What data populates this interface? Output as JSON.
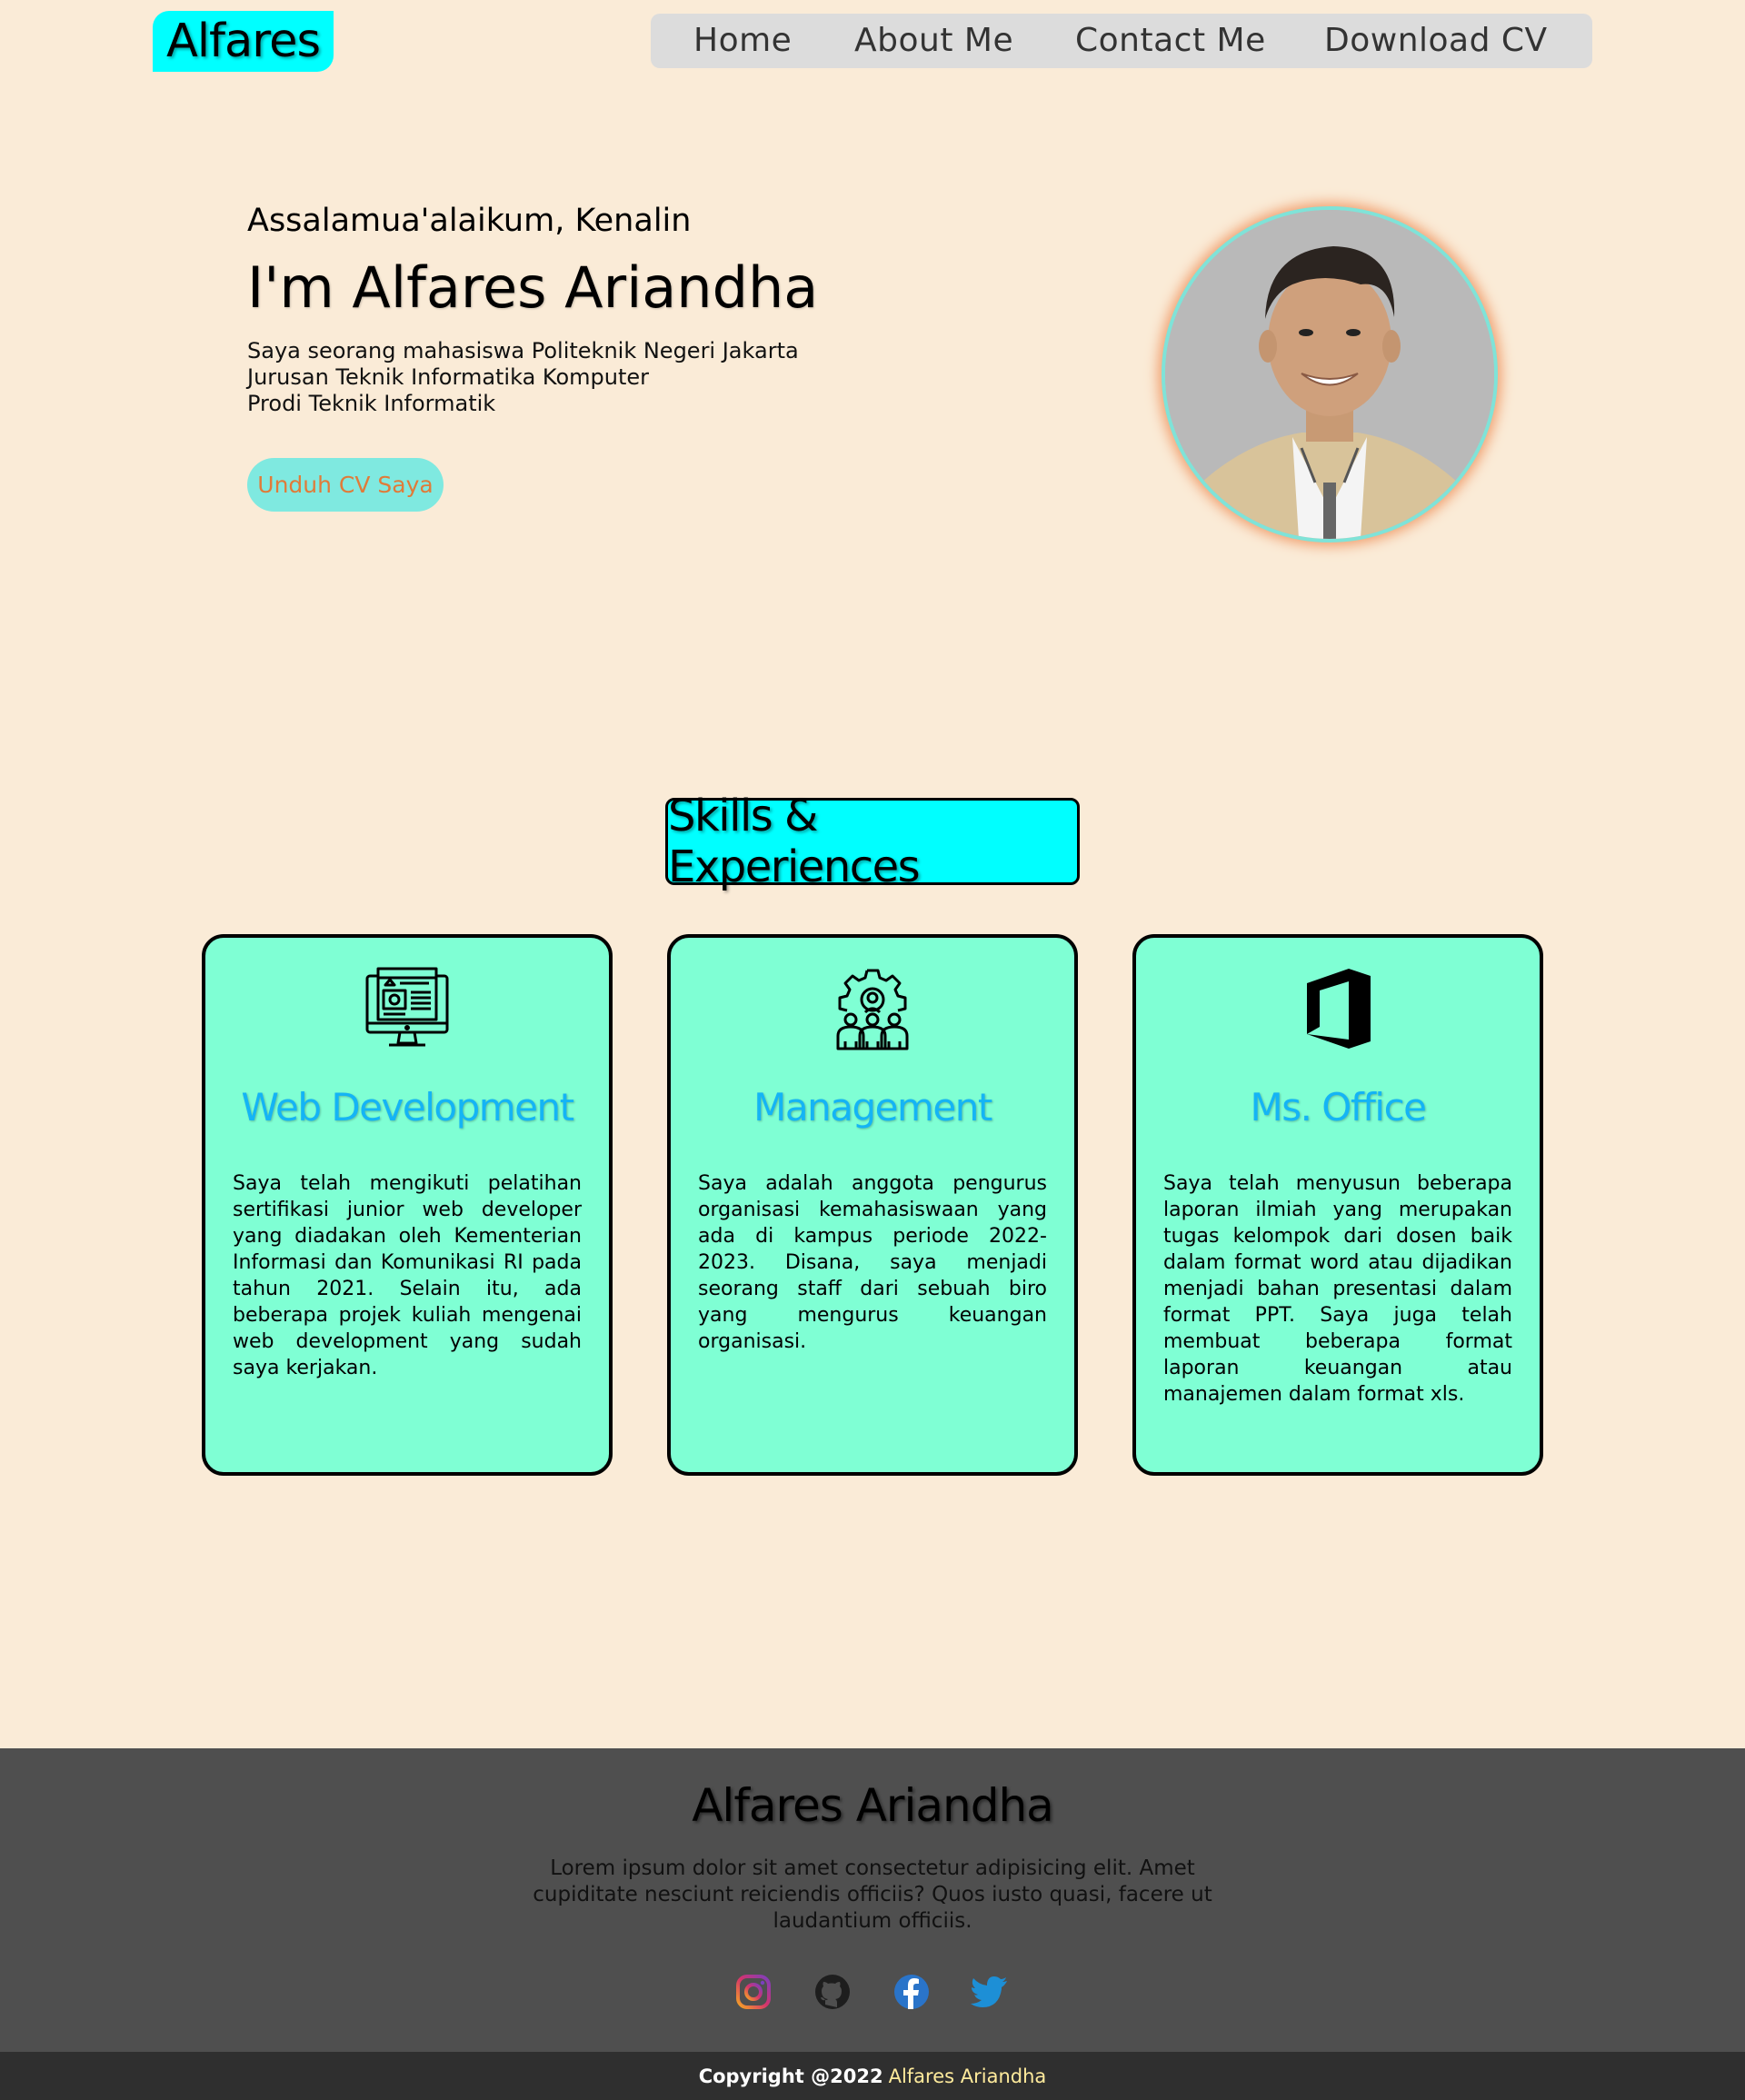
{
  "header": {
    "logo": "Alfares",
    "nav": [
      "Home",
      "About Me",
      "Contact Me",
      "Download CV"
    ]
  },
  "hero": {
    "greeting": "Assalamua'alaikum, Kenalin",
    "name": "I'm Alfares Ariandha",
    "desc": [
      "Saya seorang mahasiswa Politeknik Negeri Jakarta",
      "Jurusan Teknik Informatika Komputer",
      "Prodi Teknik Informatik"
    ],
    "cta": "Unduh CV Saya"
  },
  "skills": {
    "title": "Skills & Experiences",
    "cards": [
      {
        "icon": "web-monitor-icon",
        "title": "Web Development",
        "text": "Saya telah mengikuti pelatihan sertifikasi junior web developer yang diadakan oleh Kementerian Informasi dan Komunikasi RI pada tahun 2021. Selain itu, ada beberapa projek kuliah mengenai web development yang sudah saya kerjakan."
      },
      {
        "icon": "team-gear-icon",
        "title": "Management",
        "text": "Saya adalah anggota pengurus organisasi kemahasiswaan yang ada di kampus periode 2022-2023. Disana, saya menjadi seorang staff dari sebuah biro yang mengurus keuangan organisasi."
      },
      {
        "icon": "office-logo-icon",
        "title": "Ms. Office",
        "text": "Saya telah menyusun beberapa laporan ilmiah yang merupakan tugas kelompok dari dosen baik dalam format word atau dijadikan menjadi bahan presentasi dalam format PPT. Saya juga telah membuat beberapa format laporan keuangan atau manajemen dalam format xls."
      }
    ]
  },
  "footer": {
    "name": "Alfares Ariandha",
    "text": "Lorem ipsum dolor sit amet consectetur adipisicing elit. Amet cupiditate nesciunt reiciendis officiis? Quos iusto quasi, facere ut laudantium officiis.",
    "socials": [
      "instagram-icon",
      "github-icon",
      "facebook-icon",
      "twitter-icon"
    ],
    "copyright_prefix": "Copyright @2022",
    "copyright_name": "Alfares Ariandha"
  },
  "colors": {
    "background": "#faebd7",
    "accent_cyan": "#00ffff",
    "card": "#7fffd4",
    "card_title": "#14b4f5",
    "cta_text": "#e07b39"
  }
}
